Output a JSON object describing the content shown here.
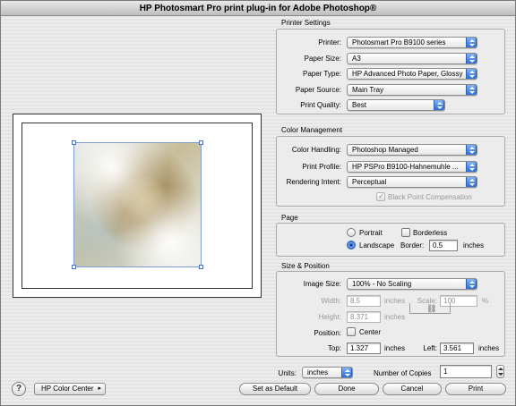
{
  "window": {
    "title": "HP Photosmart Pro print plug-in for Adobe Photoshop®"
  },
  "printer_settings": {
    "title": "Printer Settings",
    "printer_label": "Printer:",
    "printer_value": "Photosmart Pro B9100 series",
    "paper_size_label": "Paper Size:",
    "paper_size_value": "A3",
    "paper_type_label": "Paper Type:",
    "paper_type_value": "HP Advanced Photo Paper, Glossy",
    "paper_source_label": "Paper Source:",
    "paper_source_value": "Main Tray",
    "print_quality_label": "Print Quality:",
    "print_quality_value": "Best"
  },
  "color_management": {
    "title": "Color Management",
    "color_handling_label": "Color Handling:",
    "color_handling_value": "Photoshop  Managed",
    "print_profile_label": "Print Profile:",
    "print_profile_value": "HP PSPro B9100-Hahnemuhle ...",
    "rendering_intent_label": "Rendering Intent:",
    "rendering_intent_value": "Perceptual",
    "bpc_label": "Black Point Compensation",
    "bpc_checked": true
  },
  "page": {
    "title": "Page",
    "portrait_label": "Portrait",
    "landscape_label": "Landscape",
    "orientation": "landscape",
    "borderless_label": "Borderless",
    "borderless_checked": false,
    "border_label": "Border:",
    "border_value": "0.5",
    "border_unit": "inches"
  },
  "size_position": {
    "title": "Size & Position",
    "image_size_label": "Image Size:",
    "image_size_value": "100% - No Scaling",
    "width_label": "Width:",
    "width_value": "8.5",
    "width_unit": "inches",
    "scale_label": "Scale:",
    "scale_value": "100",
    "scale_unit": "%",
    "height_label": "Height:",
    "height_value": "8.371",
    "height_unit": "inches",
    "position_label": "Position:",
    "center_label": "Center",
    "center_checked": false,
    "top_label": "Top:",
    "top_value": "1.327",
    "top_unit": "inches",
    "left_label": "Left:",
    "left_value": "3.561",
    "left_unit": "inches"
  },
  "footer": {
    "units_label": "Units:",
    "units_value": "inches",
    "copies_label": "Number of Copies",
    "copies_value": "1",
    "help_symbol": "?",
    "hp_color_center_label": "HP Color Center",
    "set_default_label": "Set as Default",
    "done_label": "Done",
    "cancel_label": "Cancel",
    "print_label": "Print"
  },
  "icons": {
    "help": "help-icon",
    "popup_arrows": "popup-arrows-icon",
    "chain_link": "chain-link-icon",
    "stepper": "stepper-icon"
  },
  "colors": {
    "accent_blue": "#2f6fd8",
    "selection_handle": "#4a6fb5"
  }
}
